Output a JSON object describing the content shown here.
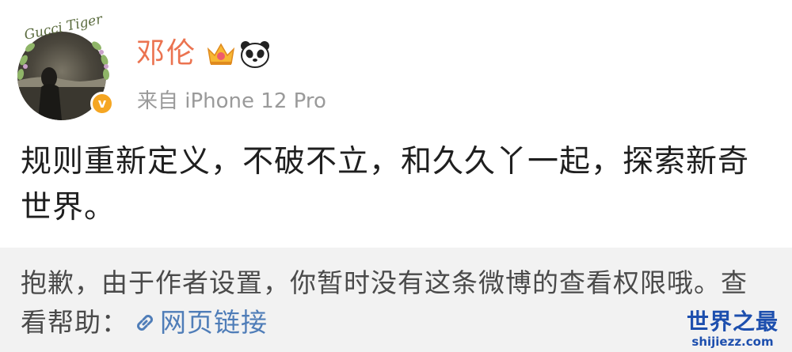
{
  "post": {
    "author": {
      "name": "邓伦",
      "avatar_signature": "Gucci Tiger",
      "verified_symbol": "v"
    },
    "source": "来自 iPhone 12 Pro",
    "text": "规则重新定义，不破不立，和久久丫一起，探索新奇世界。"
  },
  "notice": {
    "message": "抱歉，由于作者设置，你暂时没有这条微博的查看权限哦。查看帮助：",
    "link_label": "网页链接"
  },
  "watermark": {
    "title": "世界之最",
    "domain": "shijiezz.com"
  },
  "colors": {
    "name": "#eb7350",
    "link": "#4f7db8",
    "verified": "#f5a623",
    "watermark": "#1d4fae"
  },
  "icons": [
    "crown-icon",
    "panda-icon",
    "verified-icon",
    "link-icon"
  ]
}
